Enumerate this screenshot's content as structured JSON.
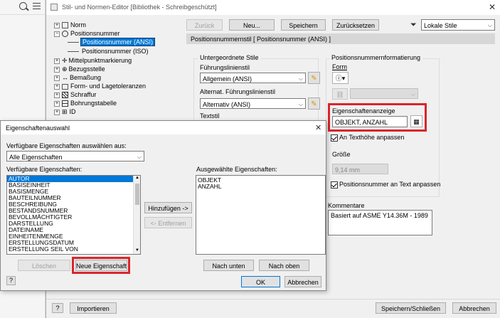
{
  "colors": {
    "accent": "#0078d7",
    "highlight_red": "#d9262b",
    "selection": "#cce8ff"
  },
  "left_panel": {
    "search_icon": "search-icon",
    "menu_icon": "hamburger-icon"
  },
  "editor": {
    "title": "Stil- und Normen-Editor [Bibliothek - Schreibgeschützt]",
    "toolbar": {
      "back": "Zurück",
      "new": "Neu...",
      "save": "Speichern",
      "reset": "Zurücksetzen",
      "filter_value": "Lokale Stile"
    },
    "tree": [
      {
        "label": "Norm",
        "expander": "+"
      },
      {
        "label": "Positionsnummer",
        "expander": "−"
      },
      {
        "label": "Positionsnummer (ANSI)",
        "selected": true
      },
      {
        "label": "Positionsnummer (ISO)"
      },
      {
        "label": "Mittelpunktmarkierung",
        "expander": "+"
      },
      {
        "label": "Bezugsstelle",
        "expander": "+"
      },
      {
        "label": "Bemaßung",
        "expander": "+"
      },
      {
        "label": "Form- und Lagetoleranzen",
        "expander": "+"
      },
      {
        "label": "Schraffur",
        "expander": "+"
      },
      {
        "label": "Bohrungstabelle",
        "expander": "+"
      },
      {
        "label": "ID",
        "expander": "+"
      }
    ],
    "style_header": "Positionsnummernstil [ Positionsnummer (ANSI) ]",
    "sub_styles": {
      "title": "Untergeordnete Stile",
      "leader_label": "Führungslinienstil",
      "leader_value": "Allgemein (ANSI)",
      "alt_leader_label": "Alternat. Führungslinienstil",
      "alt_leader_value": "Alternativ (ANSI)",
      "text_style_label": "Textstil"
    },
    "formatting": {
      "title": "Positionsnummernformatierung",
      "form_label": "Form",
      "property_display_label": "Eigenschaftenanzeige",
      "property_display_value": "OBJEKT, ANZAHL",
      "fit_text_height": "An Texthöhe anpassen",
      "size_label": "Größe",
      "size_value": "9,14 mm",
      "fit_to_text": "Positionsnummer an Text anpassen"
    },
    "comment": {
      "label": "Kommentare",
      "value": "Basiert auf ASME Y14.36M - 1989"
    },
    "bottom": {
      "import": "Importieren",
      "save_close": "Speichern/Schließen",
      "cancel": "Abbrechen"
    }
  },
  "dialog": {
    "title": "Eigenschaftenauswahl",
    "available_from_label": "Verfügbare Eigenschaften auswählen aus:",
    "available_from_value": "Alle Eigenschaften",
    "available_label": "Verfügbare Eigenschaften:",
    "available_items": [
      "AUTOR",
      "BASISEINHEIT",
      "BASISMENGE",
      "BAUTEILNUMMER",
      "BESCHREIBUNG",
      "BESTANDSNUMMER",
      "BEVOLLMÄCHTIGTER",
      "DARSTELLUNG",
      "DATEINAME",
      "EINHEITENMENGE",
      "ERSTELLUNGSDATUM",
      "ERSTELLUNG SEIL VON"
    ],
    "add_button": "Hinzufügen ->",
    "remove_button": "<- Entfernen",
    "selected_label": "Ausgewählte Eigenschaften:",
    "selected_items": [
      "OBJEKT",
      "ANZAHL"
    ],
    "delete_button": "Löschen",
    "new_property_button": "Neue Eigenschaft",
    "move_down_button": "Nach unten",
    "move_up_button": "Nach oben",
    "ok_button": "OK",
    "cancel_button": "Abbrechen"
  }
}
